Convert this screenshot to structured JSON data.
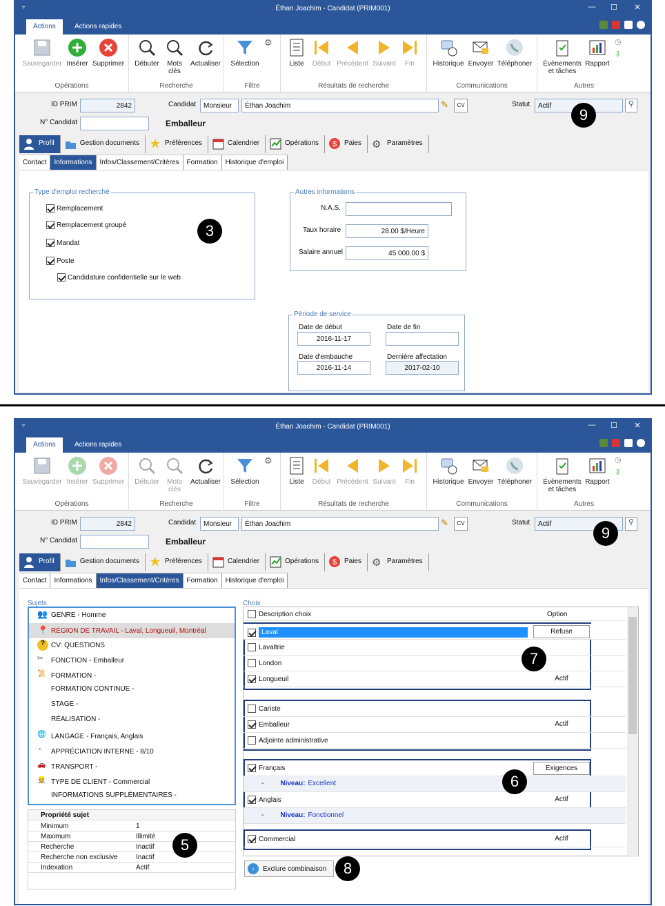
{
  "window_title": "Éthan Joachim - Candidat (PRIM001)",
  "system_menu": "▿",
  "ribbon_tabs": [
    "Actions",
    "Actions rapides"
  ],
  "ribbon": {
    "operations": {
      "label": "Opérations",
      "save": "Sauvegarder",
      "insert": "Insérer",
      "delete": "Supprimer"
    },
    "search": {
      "label": "Recherche",
      "begin": "Débuter",
      "keywords": "Mots clés",
      "refresh": "Actualiser"
    },
    "filter": {
      "label": "Filtre",
      "selection": "Sélection"
    },
    "results": {
      "label": "Résultats de recherche",
      "list": "Liste",
      "start": "Début",
      "previous": "Précédent",
      "next": "Suivant",
      "end": "Fin"
    },
    "communications": {
      "label": "Communications",
      "history": "Historique",
      "send": "Envoyer",
      "phone": "Téléphoner"
    },
    "others": {
      "label": "Autres",
      "events": "Évènements et tâches",
      "report": "Rapport"
    }
  },
  "header": {
    "id_prim_label": "ID PRIM",
    "id_prim": "2842",
    "candidate_label": "Candidat",
    "salutation": "Monsieur",
    "name": "Éthan Joachim",
    "status_label": "Statut",
    "status": "Actif",
    "candidate_no_label": "N° Candidat",
    "candidate_no": "",
    "position": "Emballeur"
  },
  "main_tabs": [
    "Profil",
    "Gestion documents",
    "Préférences",
    "Calendrier",
    "Opérations",
    "Paies",
    "Paramètres"
  ],
  "sub_tabs": [
    "Contact",
    "Informations",
    "Infos/Classement/Critères",
    "Formation",
    "Historique d'emploi"
  ],
  "panel1": {
    "job_type_title": "Type d'emploi recherché",
    "job_types": [
      {
        "label": "Remplacement",
        "checked": true
      },
      {
        "label": "Remplacement groupé",
        "checked": true
      },
      {
        "label": "Mandat",
        "checked": true
      },
      {
        "label": "Poste",
        "checked": true
      }
    ],
    "confidential": "Candidature confidentielle sur le web",
    "other_title": "Autres informations",
    "nas_label": "N.A.S.",
    "nas": "",
    "hourly_label": "Taux horaire",
    "hourly": "28.00 $/Heure",
    "annual_label": "Salaire annuel",
    "annual": "45 000.00 $",
    "service_title": "Période de service",
    "start_label": "Date de début",
    "start": "2016-11-17",
    "end_label": "Date de fin",
    "end": "",
    "hire_label": "Date d'embauche",
    "hire": "2016-11-14",
    "last_label": "Dernière affectation",
    "last": "2017-02-10"
  },
  "panel2": {
    "subjects_title": "Sujets",
    "subjects": [
      "GENRE - Homme",
      "RÉGION DE TRAVAIL - Laval, Longueuil, Montréal",
      "CV: QUESTIONS",
      "FONCTION - Emballeur",
      "FORMATION -",
      "FORMATION CONTINUE -",
      "STAGE -",
      "RÉALISATION -",
      "LANGAGE - Français, Anglais",
      "APPRÉCIATION INTERNE - 8/10",
      "TRANSPORT -",
      "TYPE DE CLIENT - Commercial",
      "INFORMATIONS SUPPLÉMENTAIRES -"
    ],
    "props_title": "Propriété sujet",
    "props": [
      [
        "Minimum",
        "1"
      ],
      [
        "Maximum",
        "Illimité"
      ],
      [
        "Recherche",
        "Inactif"
      ],
      [
        "Recherche non exclusive",
        "Inactif"
      ],
      [
        "Indexation",
        "Actif"
      ]
    ],
    "choices_title": "Choix",
    "col_desc": "Description choix",
    "col_option": "Option",
    "choices": {
      "laval": "Laval",
      "laval_opt": "Refuse",
      "lavaltrie": "Lavaltrie",
      "london": "London",
      "longueuil": "Longueuil",
      "longueuil_opt": "Actif",
      "cariste": "Cariste",
      "emballeur": "Emballeur",
      "emballeur_opt": "Actif",
      "adjointe": "Adjointe administrative",
      "francais": "Français",
      "francais_opt": "Exigences",
      "niveau_label": "Niveau:",
      "niveau_fr": "Excellent",
      "anglais": "Anglais",
      "anglais_opt": "Actif",
      "niveau_en": "Fonctionnel",
      "commercial": "Commercial",
      "commercial_opt": "Actif"
    },
    "exclude_button": "Exclure combinaison"
  },
  "callouts": {
    "b3": "3",
    "b5": "5",
    "b6": "6",
    "b7": "7",
    "b8": "8",
    "b9": "9"
  }
}
